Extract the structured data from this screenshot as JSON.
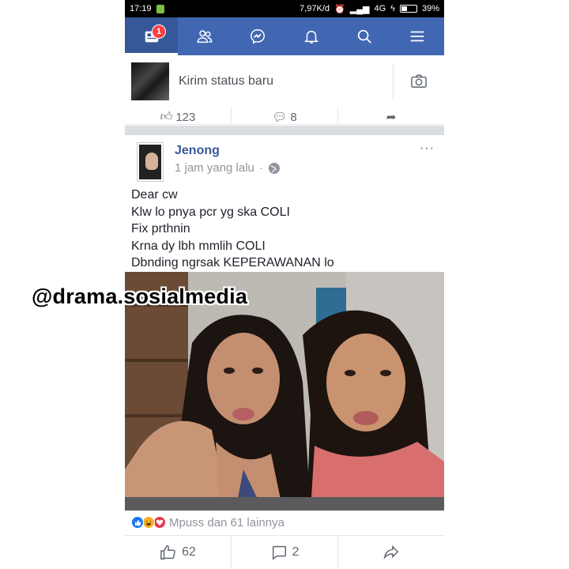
{
  "status_bar": {
    "time": "17:19",
    "network_speed": "7,97K/d",
    "network_type": "4G",
    "battery": "39%",
    "battery_level": 0.39
  },
  "nav": {
    "tabs": [
      {
        "name": "news-feed",
        "icon": "news-feed-icon",
        "badge": "1",
        "active": true
      },
      {
        "name": "friends",
        "icon": "friends-icon"
      },
      {
        "name": "messenger",
        "icon": "messenger-icon"
      },
      {
        "name": "notifications",
        "icon": "bell-icon"
      },
      {
        "name": "search",
        "icon": "search-icon"
      },
      {
        "name": "menu",
        "icon": "menu-icon"
      }
    ],
    "accent_color": "#4267b2"
  },
  "composer": {
    "prompt": "Kirim status baru",
    "camera_icon": "camera-icon"
  },
  "previous_post": {
    "likes": "123",
    "comments": "8"
  },
  "post": {
    "author": "Jenong",
    "time": "1 jam yang lalu",
    "separator": "·",
    "privacy_icon": "globe-icon",
    "more_label": "···",
    "lines": [
      "Dear cw",
      "Klw lo pnya pcr yg ska COLI",
      "Fix prthnin",
      "Krna dy lbh mmlih COLI",
      "Dbnding ngrsak KEPERAWANAN lo"
    ],
    "reactions_text": "Mpuss dan 61 lainnya",
    "reaction_icons": [
      "like-icon",
      "haha-icon",
      "love-icon"
    ],
    "like_count": "62",
    "comment_count": "2"
  },
  "watermark": "@drama.sosialmedia"
}
